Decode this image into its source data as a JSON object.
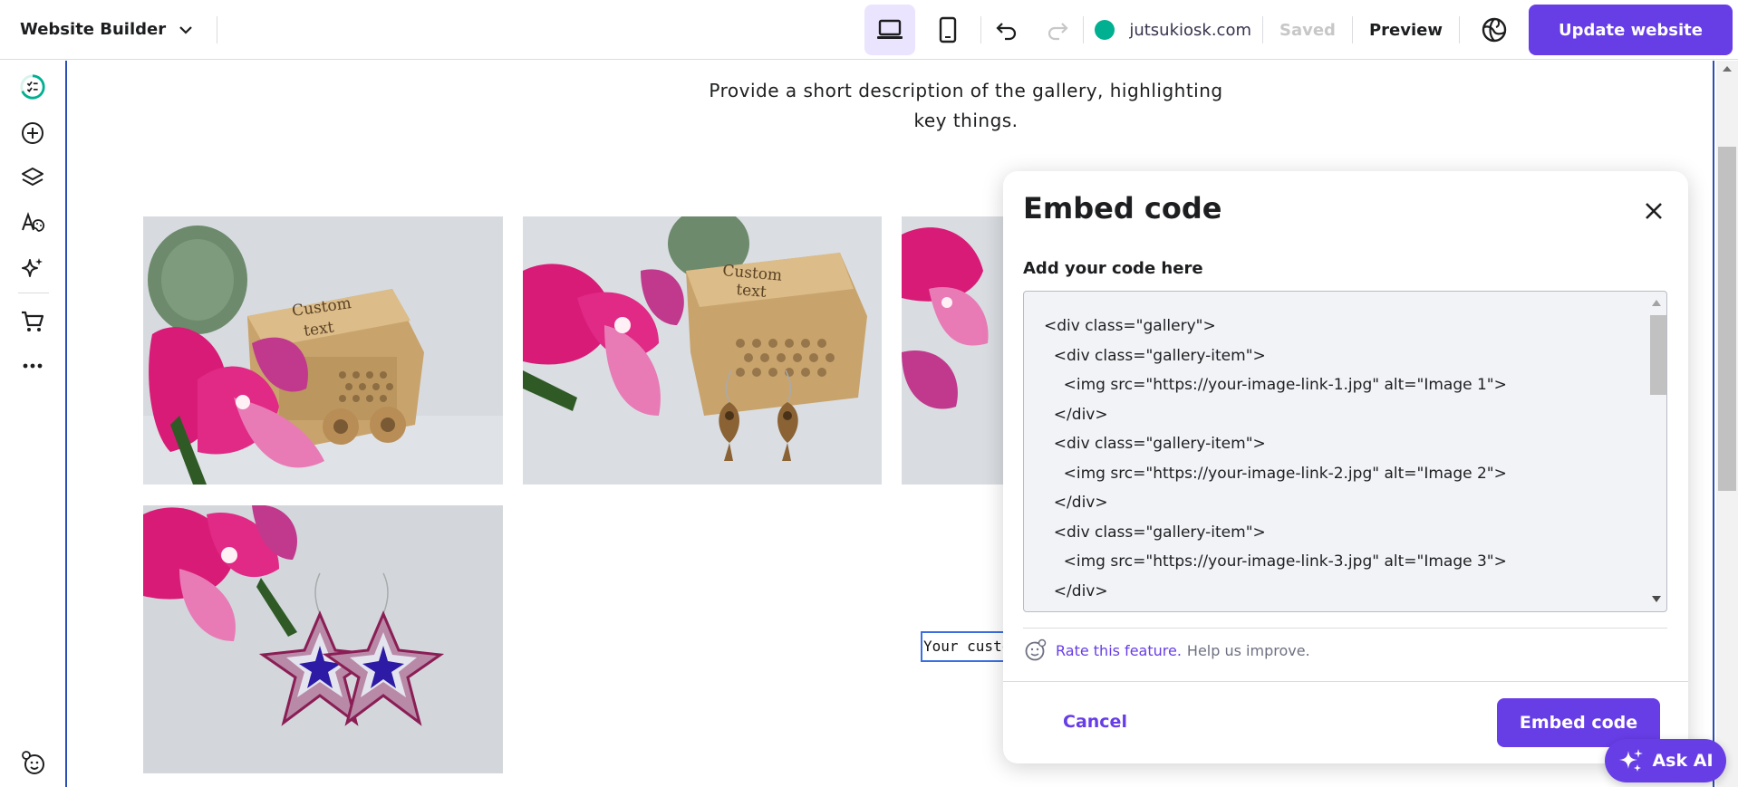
{
  "topbar": {
    "app_name": "Website Builder",
    "domain": "jutsukiosk.com",
    "saved_label": "Saved",
    "preview_label": "Preview",
    "update_label": "Update website"
  },
  "canvas": {
    "description_line1": "Provide a short description of the gallery, highlighting",
    "description_line2": "key things.",
    "custom_text": "Your custom text",
    "images": [
      {
        "caption_a": "Custom",
        "caption_b": "text"
      },
      {
        "caption_a": "Custom",
        "caption_b": "text"
      }
    ]
  },
  "modal": {
    "title": "Embed code",
    "label": "Add your code here",
    "code_lines": [
      "<div class=\"gallery\">",
      "  <div class=\"gallery-item\">",
      "    <img src=\"https://your-image-link-1.jpg\" alt=\"Image 1\">",
      "  </div>",
      "  <div class=\"gallery-item\">",
      "    <img src=\"https://your-image-link-2.jpg\" alt=\"Image 2\">",
      "  </div>",
      "  <div class=\"gallery-item\">",
      "    <img src=\"https://your-image-link-3.jpg\" alt=\"Image 3\">",
      "  </div>"
    ],
    "rate_link": "Rate this feature.",
    "rate_rest": "Help us improve.",
    "cancel_label": "Cancel",
    "embed_label": "Embed code"
  },
  "ask_ai_label": "Ask AI",
  "colors": {
    "accent": "#673de6",
    "status_dot": "#00b090",
    "selection": "#2b4fb5"
  }
}
